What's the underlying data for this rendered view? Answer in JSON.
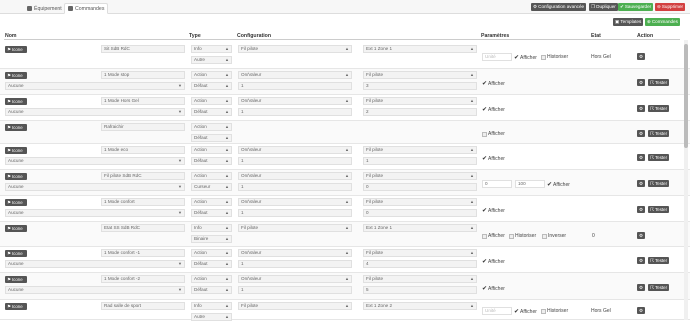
{
  "tabs": [
    {
      "label": "Équipement",
      "icon": "gear-icon"
    },
    {
      "label": "Commandes",
      "icon": "list-icon"
    }
  ],
  "toolbar": {
    "config_label": "Configuration avancée",
    "duplicate_label": "Dupliquer",
    "save_label": "Sauvegarder",
    "delete_label": "Supprimer",
    "templates_label": "Templates",
    "add_command_label": "Commandes"
  },
  "headers": {
    "nom": "Nom",
    "type": "Type",
    "configuration": "Configuration",
    "parametres": "Paramètres",
    "etat": "Etat",
    "action": "Action"
  },
  "icon_button_label": "Icone",
  "param_labels": {
    "afficher": "Afficher",
    "historiser": "Historiser",
    "inverser": "Inverser",
    "unite_placeholder": "Unité"
  },
  "action_labels": {
    "configure": "",
    "test": "Tester"
  },
  "rows": [
    {
      "kind": "info",
      "name": "Sit SdB RdC",
      "type1": "Info",
      "type2": "Autre",
      "conf1": "Fil pilote",
      "conf2": "Ext 1 Zone 1",
      "unite": "Unité",
      "afficher": true,
      "historiser": false,
      "etat": "Hors Gel"
    },
    {
      "kind": "action",
      "name": "1 Mode stop",
      "parent": "Aucune",
      "type1": "Action",
      "type2": "Défaut",
      "conf1": "On/Valeur",
      "conf2": "Fil pilote",
      "val1": "1",
      "val2": "3",
      "afficher": true
    },
    {
      "kind": "action",
      "name": "1 Mode Hors Gel",
      "parent": "Aucune",
      "type1": "Action",
      "type2": "Défaut",
      "conf1": "On/Valeur",
      "conf2": "Fil pilote",
      "val1": "1",
      "val2": "2",
      "afficher": true
    },
    {
      "kind": "empty",
      "name": "Rafraichir",
      "type1": "Action",
      "type2": "Défaut",
      "afficher": false
    },
    {
      "kind": "action",
      "name": "1 Mode eco",
      "parent": "Aucune",
      "type1": "Action",
      "type2": "Défaut",
      "conf1": "On/Valeur",
      "conf2": "Fil pilote",
      "val1": "1",
      "val2": "1",
      "afficher": true
    },
    {
      "kind": "slider",
      "name": "Fil pilote SdB RdC",
      "parent": "Aucune",
      "type1": "Action",
      "type2": "Curseur",
      "conf1": "On/Valeur",
      "conf2": "Fil pilote",
      "val1": "1",
      "val2": "0",
      "min": "0",
      "max": "100",
      "afficher": true
    },
    {
      "kind": "action",
      "name": "1 Mode confort",
      "parent": "Aucune",
      "type1": "Action",
      "type2": "Défaut",
      "conf1": "On/Valeur",
      "conf2": "Fil pilote",
      "val1": "1",
      "val2": "0",
      "afficher": true
    },
    {
      "kind": "info2",
      "name": "Etat SS SdB RdC",
      "type1": "Info",
      "type2": "Binaire",
      "conf1": "Fil pilote",
      "conf2": "Ext 1 Zone 1",
      "afficher": false,
      "historiser": false,
      "inverser": false,
      "etat": "0"
    },
    {
      "kind": "action",
      "name": "1 Mode confort -1",
      "parent": "Aucune",
      "type1": "Action",
      "type2": "Défaut",
      "conf1": "On/Valeur",
      "conf2": "Fil pilote",
      "val1": "1",
      "val2": "4",
      "afficher": true
    },
    {
      "kind": "action",
      "name": "1 Mode confort -2",
      "parent": "Aucune",
      "type1": "Action",
      "type2": "Défaut",
      "conf1": "On/Valeur",
      "conf2": "Fil pilote",
      "val1": "1",
      "val2": "5",
      "afficher": true
    },
    {
      "kind": "info",
      "name": "Rad salle de sport",
      "type1": "Info",
      "type2": "Autre",
      "conf1": "Fil pilote",
      "conf2": "Ext 1 Zone 2",
      "unite": "Unité",
      "afficher": true,
      "historiser": false,
      "etat": "Hors Gel"
    }
  ]
}
